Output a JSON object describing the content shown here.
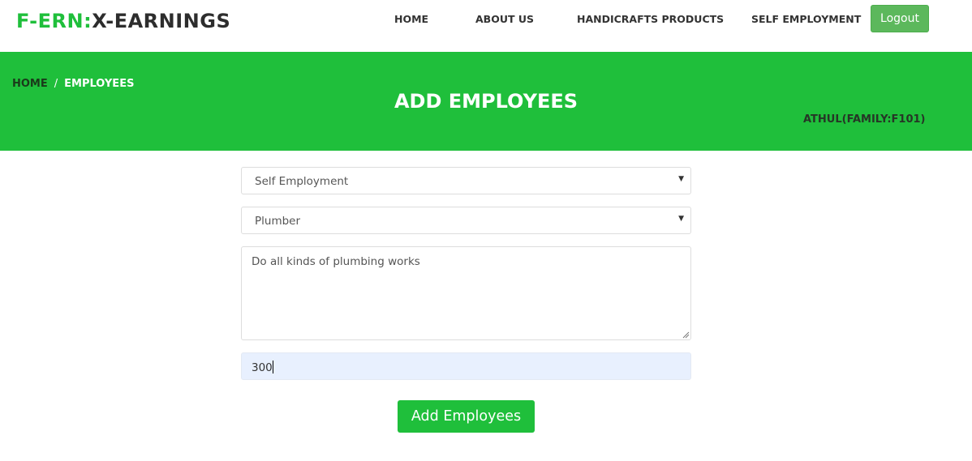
{
  "brand": {
    "prefix": "F-ERN:",
    "suffix": "X-EARNINGS"
  },
  "nav": {
    "items": [
      {
        "label": "HOME"
      },
      {
        "label": "ABOUT US"
      },
      {
        "label": "HANDICRAFTS PRODUCTS"
      },
      {
        "label": "SELF EMPLOYMENT"
      }
    ],
    "logout_label": "Logout"
  },
  "banner": {
    "breadcrumb": {
      "home": "HOME",
      "separator": "/",
      "current": "EMPLOYEES"
    },
    "title": "ADD EMPLOYEES",
    "user": "ATHUL(FAMILY:F101)"
  },
  "form": {
    "category_select": {
      "value": "Self Employment"
    },
    "job_select": {
      "value": "Plumber"
    },
    "description": {
      "value": "Do all kinds of plumbing works"
    },
    "amount": {
      "value": "300"
    },
    "submit_label": "Add Employees"
  },
  "colors": {
    "accent_green": "#1fbf3b",
    "logout_green": "#5cb85c",
    "autofill_blue": "#e8f0fe"
  }
}
